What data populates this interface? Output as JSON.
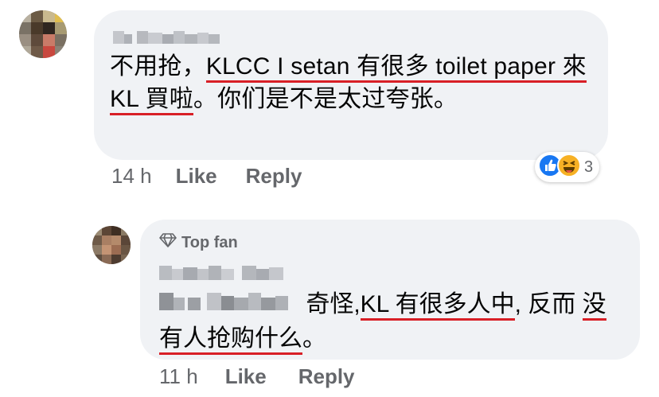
{
  "comment": {
    "author": "La Wande",
    "text_plain_1": "不用抢，",
    "text_underlined_1": "KLCC I setan 有很多 toilet paper 來 KL 買啦",
    "text_plain_2": "。你们是不是太过夸张。",
    "reaction_count": "3",
    "reactions": [
      "like-icon",
      "haha-icon"
    ],
    "time": "14 h",
    "like_label": "Like",
    "reply_label": "Reply"
  },
  "reply": {
    "badge": "Top fan",
    "author": "Jasmine Cha",
    "mention": "La Wande",
    "text_plain_1": " 奇怪,",
    "text_underlined_1": "KL 有很多人中",
    "text_plain_2": ", 反而 ",
    "text_underlined_2": "没有人抢购什么",
    "text_plain_3": "。",
    "time": "11 h",
    "like_label": "Like",
    "reply_label": "Reply"
  },
  "colors": {
    "bubble": "#f0f2f5",
    "underline": "#d81f26",
    "meta": "#65676b",
    "like_blue": "#1877f2",
    "haha_yellow": "#f7b125"
  }
}
